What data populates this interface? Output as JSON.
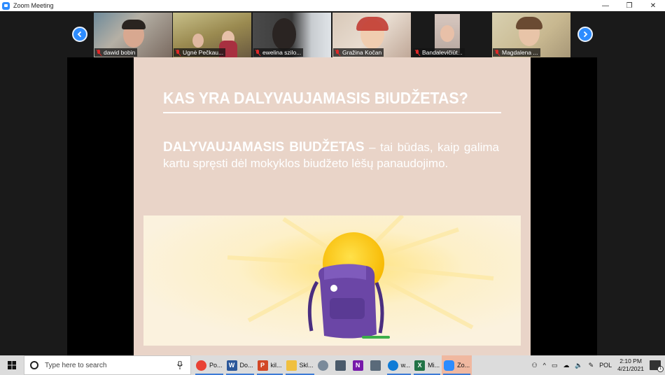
{
  "window": {
    "title": "Zoom Meeting",
    "controls": {
      "minimize": "—",
      "restore": "❐",
      "close": "✕"
    }
  },
  "gallery": {
    "prev_icon": "chevron-left-icon",
    "next_icon": "chevron-right-icon",
    "participants": [
      {
        "name": "dawid bobin",
        "muted": true
      },
      {
        "name": "Ugnė Pečkau...",
        "muted": true
      },
      {
        "name": "ewelina szilo...",
        "muted": true
      },
      {
        "name": "Gražina Kočan",
        "muted": true
      },
      {
        "name": "Bandalevičiūt...",
        "muted": true
      },
      {
        "name": "Magdalena ...",
        "muted": true
      }
    ]
  },
  "slide": {
    "title": "KAS YRA DALYVAUJAMASIS BIUDŽETAS?",
    "term": "DALYVAUJAMASIS BIUDŽETAS",
    "definition": " – tai būdas, kaip galima kartu spręsti dėl mokyklos biudžeto lėšų panaudojimo."
  },
  "taskbar": {
    "search_placeholder": "Type here to search",
    "apps": [
      {
        "label": "Po...",
        "icon": "chrome-icon",
        "color": "#e94235"
      },
      {
        "label": "Do...",
        "icon": "word-icon",
        "color": "#2b579a"
      },
      {
        "label": "kil...",
        "icon": "powerpoint-icon",
        "color": "#d24726"
      },
      {
        "label": "Skl...",
        "icon": "folder-icon",
        "color": "#f0c040"
      },
      {
        "label": "",
        "icon": "paint-icon",
        "color": "#7a8a9a"
      },
      {
        "label": "",
        "icon": "calculator-icon",
        "color": "#4a5a6a"
      },
      {
        "label": "",
        "icon": "onenote-icon",
        "color": "#7719aa"
      },
      {
        "label": "",
        "icon": "window-icon",
        "color": "#5a6a7a"
      },
      {
        "label": "w...",
        "icon": "edge-icon",
        "color": "#0f7bd6"
      },
      {
        "label": "Mi...",
        "icon": "excel-icon",
        "color": "#217346"
      },
      {
        "label": "Zo...",
        "icon": "zoom-icon",
        "color": "#2d8cff",
        "active": true
      }
    ],
    "language": "POL",
    "time": "2:10 PM",
    "date": "4/21/2021",
    "notifications": "1"
  }
}
